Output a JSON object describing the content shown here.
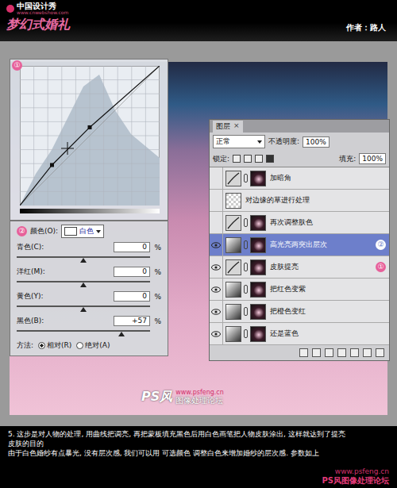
{
  "header": {
    "logo": "中国设计秀",
    "logo_url": "www.cnwebshow.com",
    "title": "梦幻式婚礼",
    "author": "作者：路人"
  },
  "curves": {
    "badge": "①",
    "points": [
      [
        0,
        0
      ],
      [
        0.23,
        0.29
      ],
      [
        0.5,
        0.56
      ],
      [
        1,
        1
      ]
    ]
  },
  "color_panel": {
    "badge": "②",
    "label": "颜色(O):",
    "value": "白色",
    "percent": "%",
    "sliders": [
      {
        "label": "青色(C):",
        "value": "0",
        "level": 0.5
      },
      {
        "label": "洋红(M):",
        "value": "0",
        "level": 0.5
      },
      {
        "label": "黄色(Y):",
        "value": "0",
        "level": 0.5
      },
      {
        "label": "黑色(B):",
        "value": "+57",
        "level": 0.785
      }
    ],
    "method_label": "方法:",
    "methods": [
      {
        "label": "相对(R)",
        "selected": true
      },
      {
        "label": "绝对(A)",
        "selected": false
      }
    ]
  },
  "layers_panel": {
    "tab": "图层",
    "close": "×",
    "blend": "正常",
    "opacity_label": "不透明度:",
    "opacity": "100%",
    "lock_label": "锁定:",
    "fill_label": "填充:",
    "fill": "100%",
    "layers": [
      {
        "name": "加暗角",
        "kind": "curves",
        "visible": false,
        "selected": false,
        "badge": ""
      },
      {
        "name": "对边缘的草进行处理",
        "kind": "pixel",
        "visible": false,
        "selected": false,
        "badge": ""
      },
      {
        "name": "再次调整肤色",
        "kind": "curves",
        "visible": false,
        "selected": false,
        "badge": ""
      },
      {
        "name": "高光亮两突出层次",
        "kind": "color",
        "visible": true,
        "selected": true,
        "badge": "②"
      },
      {
        "name": "皮肤提亮",
        "kind": "curves",
        "visible": true,
        "selected": false,
        "badge": "①"
      },
      {
        "name": "把红色变紫",
        "kind": "color",
        "visible": true,
        "selected": false,
        "badge": ""
      },
      {
        "name": "把橙色变红",
        "kind": "color",
        "visible": true,
        "selected": false,
        "badge": ""
      },
      {
        "name": "还是蓝色",
        "kind": "color",
        "visible": true,
        "selected": false,
        "badge": ""
      }
    ]
  },
  "watermark": {
    "logo": "PS风",
    "url": "www.psfeng.cn",
    "tagline": "图像处理论坛"
  },
  "caption": [
    "5. 这步是对人物的处理, 用曲线把调亮, 再把蒙板填充黑色后用白色画笔把人物皮肤涂出, 这样就达到了提亮",
    "皮肤的目的",
    "由于白色婚纱有点暴光, 没有层次感, 我们可以用 可选颜色 调整白色来增加婚纱的层次感. 参数如上"
  ],
  "footer": {
    "url": "www.psfeng.cn",
    "name": "PS风图像处理论坛"
  }
}
